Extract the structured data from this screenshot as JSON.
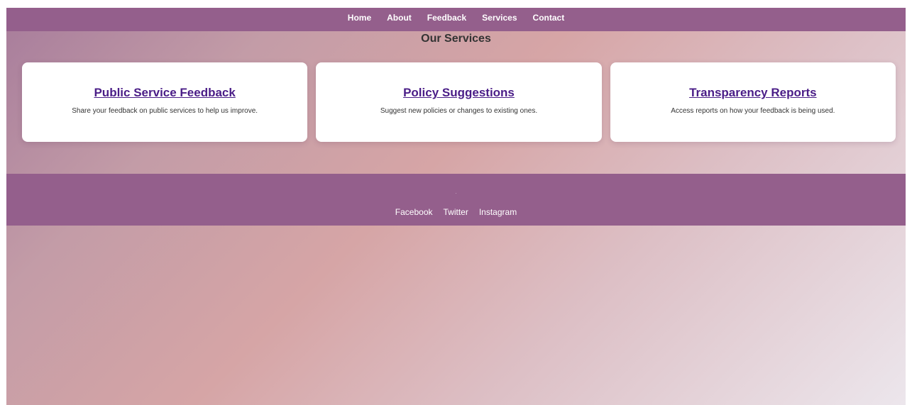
{
  "nav": {
    "items": [
      {
        "label": "Home"
      },
      {
        "label": "About"
      },
      {
        "label": "Feedback"
      },
      {
        "label": "Services"
      },
      {
        "label": "Contact"
      }
    ]
  },
  "services": {
    "title": "Our Services",
    "cards": [
      {
        "title": "Public Service Feedback",
        "description": "Share your feedback on public services to help us improve."
      },
      {
        "title": "Policy Suggestions",
        "description": "Suggest new policies or changes to existing ones."
      },
      {
        "title": "Transparency Reports",
        "description": "Access reports on how your feedback is being used."
      }
    ]
  },
  "footer": {
    "dot": ".",
    "social": [
      {
        "label": "Facebook"
      },
      {
        "label": "Twitter"
      },
      {
        "label": "Instagram"
      }
    ]
  },
  "colors": {
    "nav_bg": "#945f8c",
    "footer_bg": "#945f8c",
    "link": "#4a1d87",
    "card_bg": "#ffffff"
  }
}
